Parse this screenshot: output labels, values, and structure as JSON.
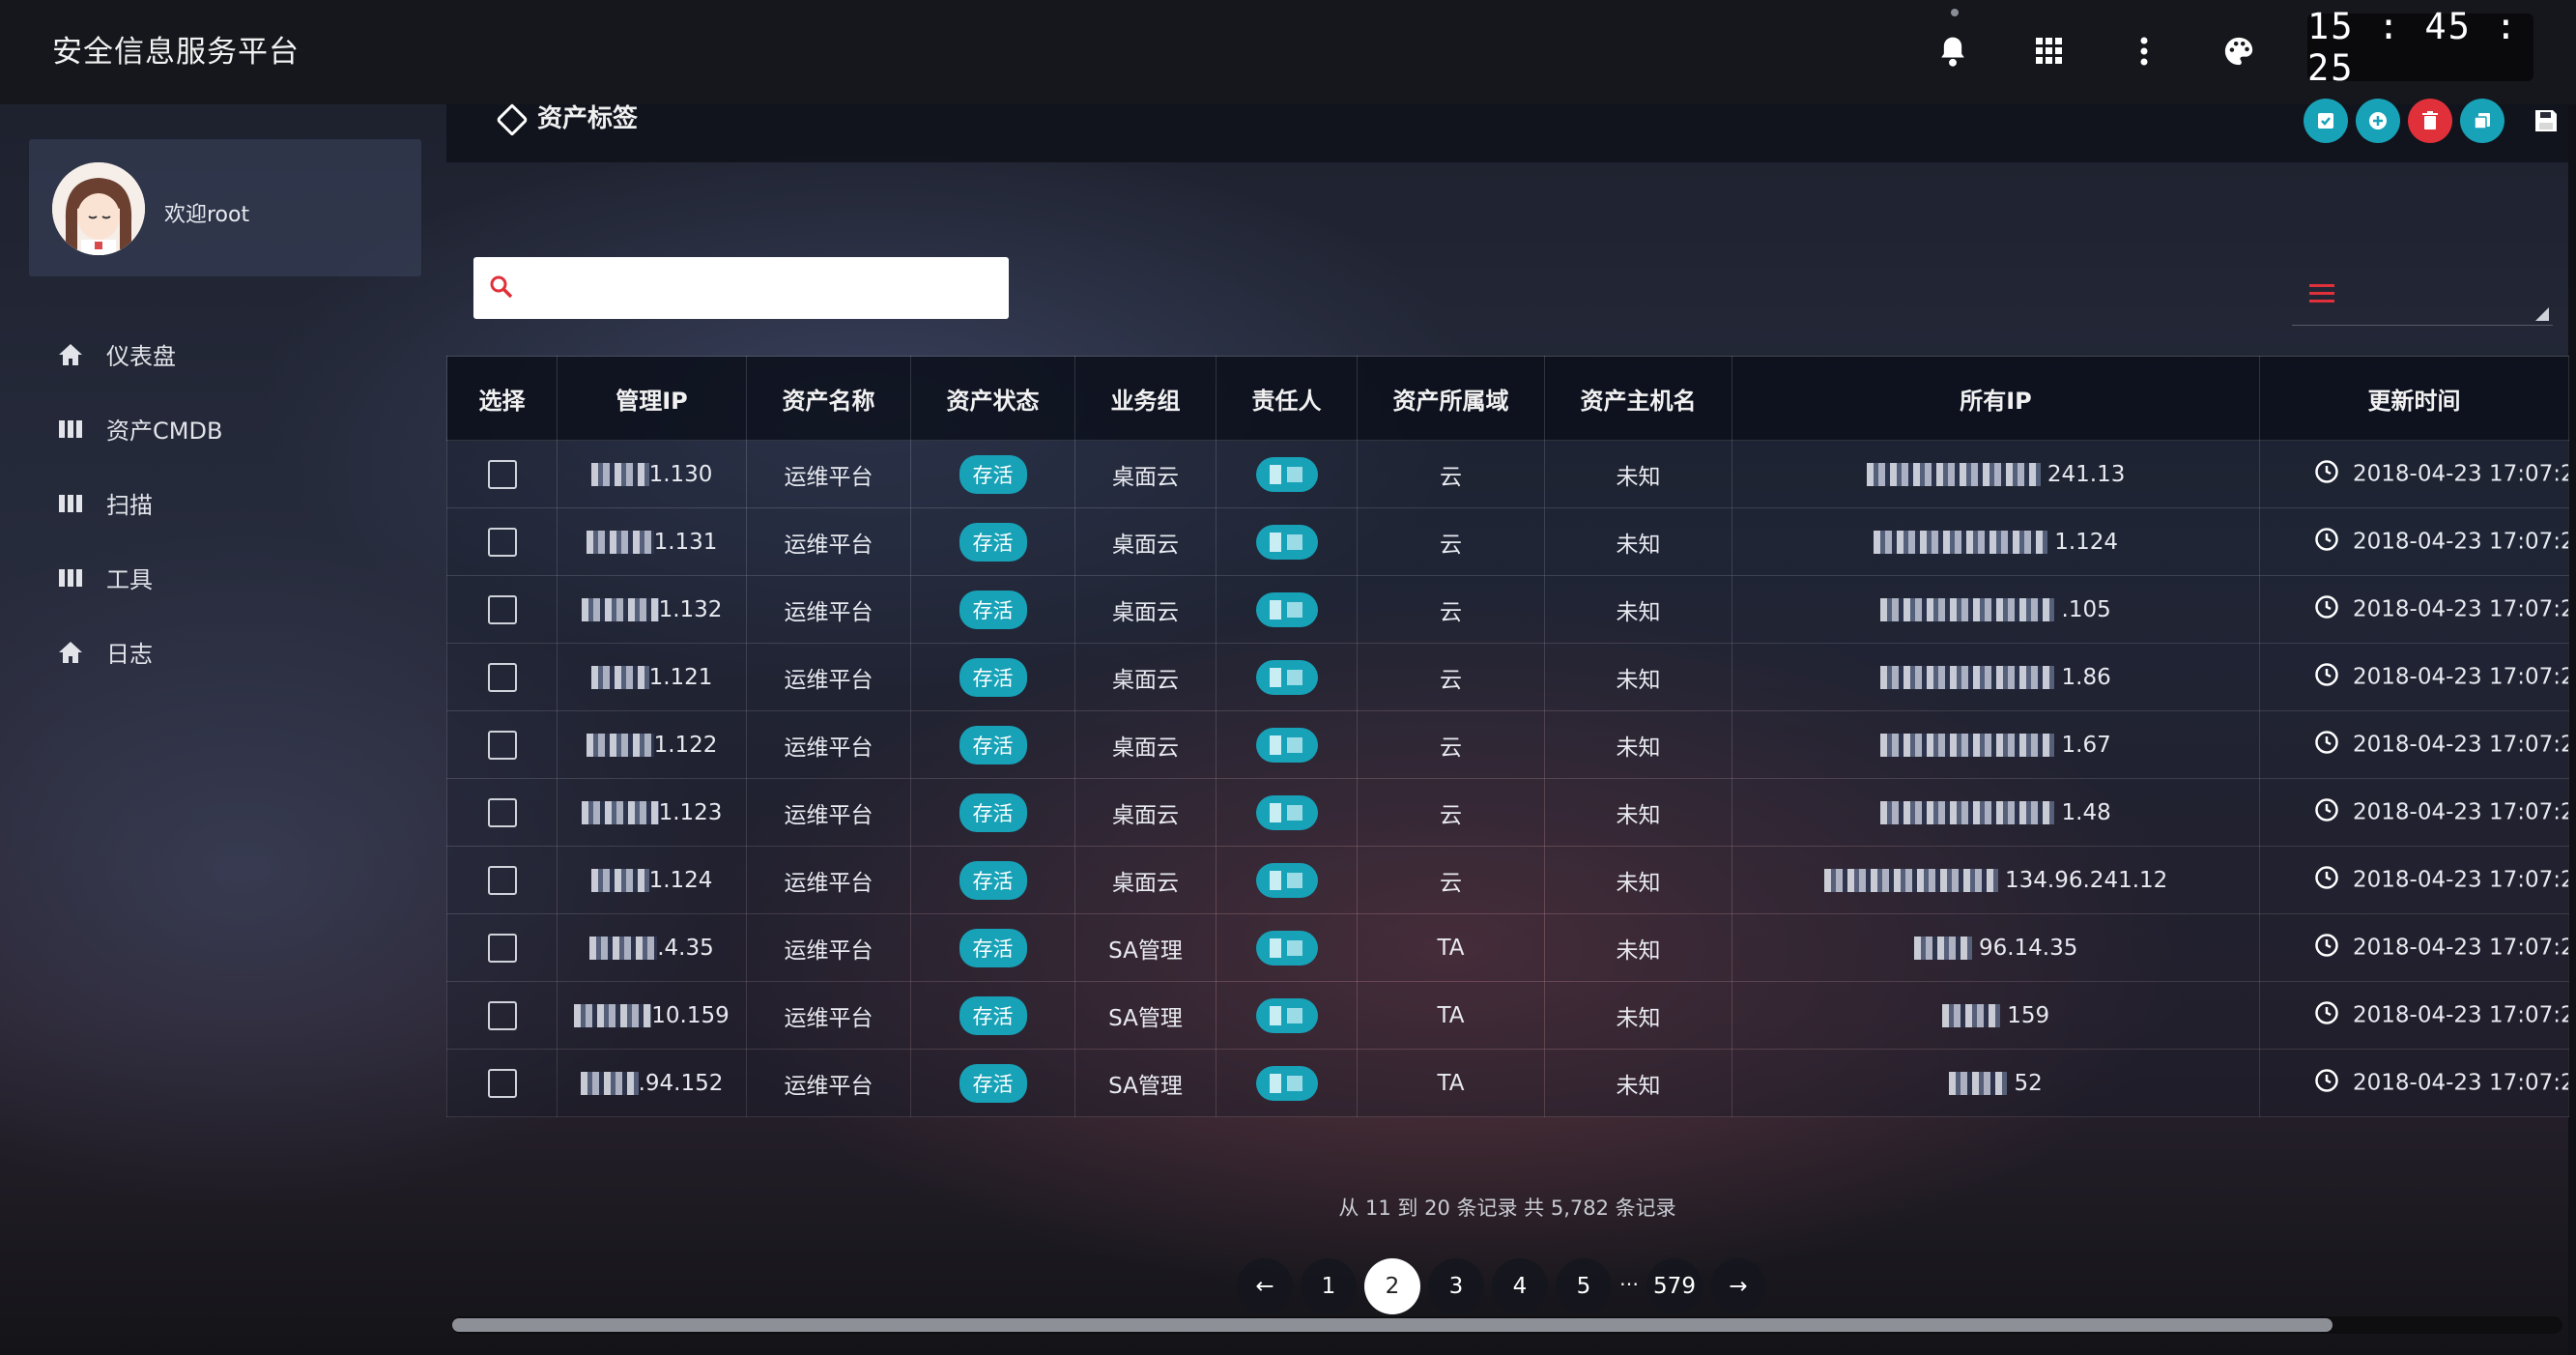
{
  "app": {
    "title": "安全信息服务平台",
    "clock": "15 : 45 : 25"
  },
  "user": {
    "welcome": "欢迎root"
  },
  "sidebar": {
    "items": [
      {
        "label": "仪表盘",
        "icon": "home-icon"
      },
      {
        "label": "资产CMDB",
        "icon": "columns-icon"
      },
      {
        "label": "扫描",
        "icon": "columns-icon"
      },
      {
        "label": "工具",
        "icon": "columns-icon"
      },
      {
        "label": "日志",
        "icon": "home-icon"
      }
    ]
  },
  "breadcrumb": {
    "label": "资产标签"
  },
  "search": {
    "placeholder": ""
  },
  "colors": {
    "accent": "#17a2b8",
    "danger": "#e0303a"
  },
  "table": {
    "headers": [
      "选择",
      "管理IP",
      "资产名称",
      "资产状态",
      "业务组",
      "责任人",
      "资产所属域",
      "资产主机名",
      "所有IP",
      "更新时间"
    ],
    "rows": [
      {
        "ip_suffix": "1.130",
        "name": "运维平台",
        "status": "存活",
        "group": "桌面云",
        "domain": "云",
        "host": "未知",
        "all_ip": "241.13",
        "updated": "2018-04-23 17:07:2"
      },
      {
        "ip_suffix": "1.131",
        "name": "运维平台",
        "status": "存活",
        "group": "桌面云",
        "domain": "云",
        "host": "未知",
        "all_ip": "1.124",
        "updated": "2018-04-23 17:07:2"
      },
      {
        "ip_suffix": "1.132",
        "name": "运维平台",
        "status": "存活",
        "group": "桌面云",
        "domain": "云",
        "host": "未知",
        "all_ip": ".105",
        "updated": "2018-04-23 17:07:2"
      },
      {
        "ip_suffix": "1.121",
        "name": "运维平台",
        "status": "存活",
        "group": "桌面云",
        "domain": "云",
        "host": "未知",
        "all_ip": "1.86",
        "updated": "2018-04-23 17:07:2"
      },
      {
        "ip_suffix": "1.122",
        "name": "运维平台",
        "status": "存活",
        "group": "桌面云",
        "domain": "云",
        "host": "未知",
        "all_ip": "1.67",
        "updated": "2018-04-23 17:07:2"
      },
      {
        "ip_suffix": "1.123",
        "name": "运维平台",
        "status": "存活",
        "group": "桌面云",
        "domain": "云",
        "host": "未知",
        "all_ip": "1.48",
        "updated": "2018-04-23 17:07:2"
      },
      {
        "ip_suffix": "1.124",
        "name": "运维平台",
        "status": "存活",
        "group": "桌面云",
        "domain": "云",
        "host": "未知",
        "all_ip": "134.96.241.12",
        "updated": "2018-04-23 17:07:2"
      },
      {
        "ip_suffix": ".4.35",
        "name": "运维平台",
        "status": "存活",
        "group": "SA管理",
        "domain": "TA",
        "host": "未知",
        "all_ip": "96.14.35",
        "updated": "2018-04-23 17:07:2"
      },
      {
        "ip_suffix": "10.159",
        "name": "运维平台",
        "status": "存活",
        "group": "SA管理",
        "domain": "TA",
        "host": "未知",
        "all_ip": "159",
        "updated": "2018-04-23 17:07:2"
      },
      {
        "ip_suffix": ".94.152",
        "name": "运维平台",
        "status": "存活",
        "group": "SA管理",
        "domain": "TA",
        "host": "未知",
        "all_ip": "52",
        "updated": "2018-04-23 17:07:2"
      }
    ]
  },
  "pagination": {
    "summary": "从 11 到 20 条记录 共 5,782 条记录",
    "prev": "←",
    "pages": [
      "1",
      "2",
      "3",
      "4",
      "5"
    ],
    "current": "2",
    "ellipsis": "…",
    "last": "579",
    "next": "→"
  }
}
